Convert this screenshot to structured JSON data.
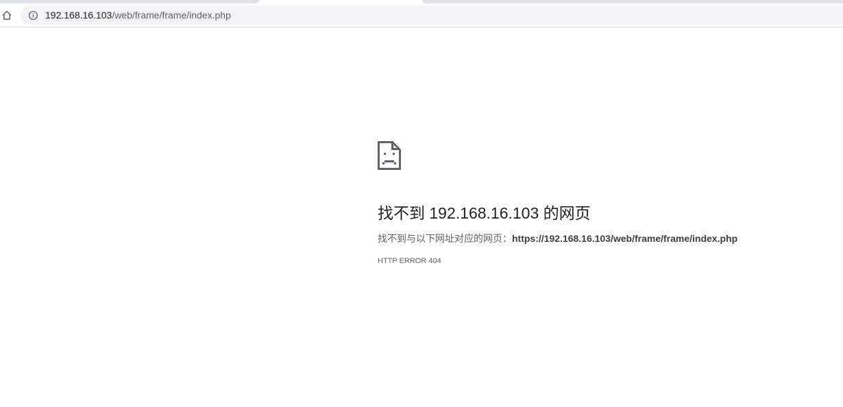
{
  "browser": {
    "address_bar": {
      "host": "192.168.16.103",
      "path": "/web/frame/frame/index.php"
    },
    "icons": {
      "home": "home-icon",
      "site_info": "info-icon"
    }
  },
  "error_page": {
    "icon": "sad-document-icon",
    "title": "找不到 192.168.16.103 的网页",
    "description_prefix": "找不到与以下网址对应的网页：",
    "description_url": "https://192.168.16.103/web/frame/frame/index.php",
    "error_code": "HTTP ERROR 404"
  },
  "colors": {
    "toolbar_bg": "#ffffff",
    "omnibox_bg": "#f1f3f4",
    "title_text": "#202124",
    "secondary_text": "#5f6368"
  }
}
